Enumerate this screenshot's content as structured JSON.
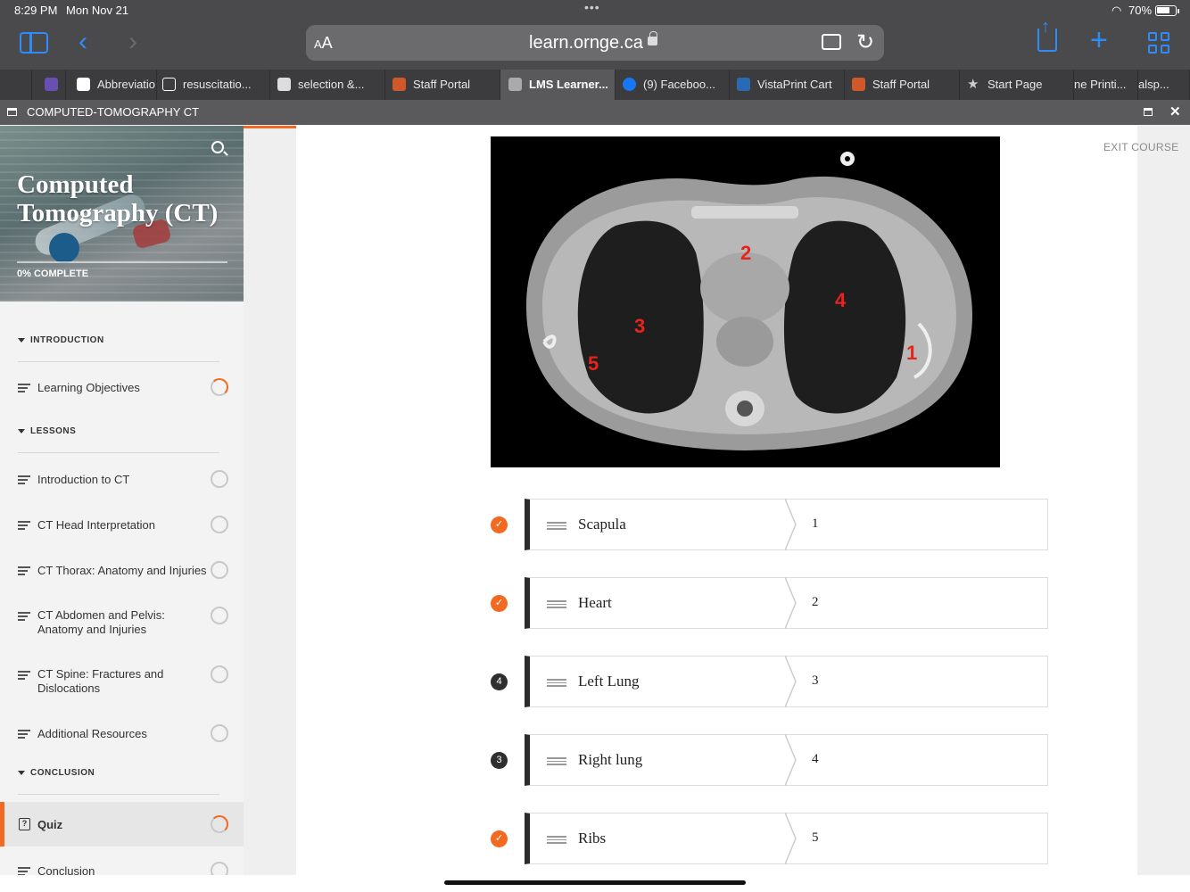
{
  "status_bar": {
    "time": "8:29 PM",
    "date": "Mon Nov 21",
    "battery": "70%"
  },
  "browser": {
    "address_aa": "AA",
    "url": "learn.ornge.ca",
    "tabs": [
      {
        "label": "Abbreviatio"
      },
      {
        "label": "resuscitatio..."
      },
      {
        "label": "selection &..."
      },
      {
        "label": "Staff Portal"
      },
      {
        "label": "LMS Learner..."
      },
      {
        "label": "(9) Faceboo..."
      },
      {
        "label": "VistaPrint Cart"
      },
      {
        "label": "Staff Portal"
      },
      {
        "label": "Start Page"
      },
      {
        "label": "ne Printi..."
      },
      {
        "label": "alsp..."
      }
    ]
  },
  "course_window": {
    "title": "COMPUTED-TOMOGRAPHY CT"
  },
  "sidebar": {
    "course_title": "Computed Tomography (CT)",
    "progress_label": "0% COMPLETE",
    "sections": [
      {
        "title": "INTRODUCTION",
        "items": [
          "Learning Objectives"
        ]
      },
      {
        "title": "LESSONS",
        "items": [
          "Introduction to CT",
          "CT Head Interpretation",
          "CT Thorax: Anatomy and Injuries",
          "CT Abdomen and Pelvis: Anatomy and Injuries",
          "CT Spine: Fractures and Dislocations",
          "Additional Resources"
        ]
      },
      {
        "title": "CONCLUSION",
        "items": [
          "Quiz",
          "Conclusion"
        ]
      }
    ]
  },
  "main": {
    "exit_label": "EXIT COURSE",
    "image_labels": [
      "1",
      "2",
      "3",
      "4",
      "5"
    ],
    "matches": [
      {
        "status": "correct",
        "marker": "",
        "item": "Scapula",
        "answer": "1"
      },
      {
        "status": "correct",
        "marker": "",
        "item": "Heart",
        "answer": "2"
      },
      {
        "status": "hint",
        "marker": "4",
        "item": "Left Lung",
        "answer": "3"
      },
      {
        "status": "hint",
        "marker": "3",
        "item": "Right lung",
        "answer": "4"
      },
      {
        "status": "correct",
        "marker": "",
        "item": "Ribs",
        "answer": "5"
      }
    ]
  }
}
